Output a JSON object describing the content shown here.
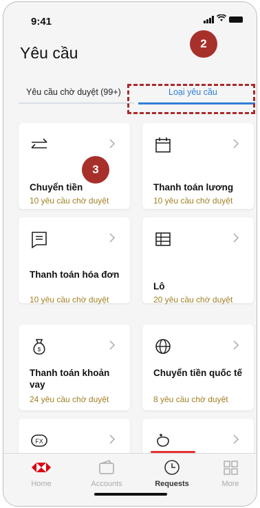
{
  "status_bar": {
    "time": "9:41"
  },
  "header": {
    "title": "Yêu cầu"
  },
  "tabs": [
    {
      "label": "Yêu cầu chờ duyệt (99+)"
    },
    {
      "label": "Loại yêu cầu"
    }
  ],
  "annotations": {
    "badge_2": "2",
    "badge_3": "3"
  },
  "cards": [
    {
      "name": "Chuyển tiền",
      "count": "10 yêu cầu chờ duyệt",
      "icon": "transfer-arrows-icon"
    },
    {
      "name": "Thanh toán lương",
      "count": "10 yêu cầu chờ duyệt",
      "icon": "calendar-icon"
    },
    {
      "name": "Thanh toán hóa đơn",
      "count": "10 yêu cầu chờ duyệt",
      "icon": "bill-icon"
    },
    {
      "name": "Lô",
      "count": "20 yêu cầu chờ duyệt",
      "icon": "table-icon"
    },
    {
      "name": "Thanh toán khoản vay",
      "count": "24 yêu cầu chờ duyệt",
      "icon": "money-bag-icon"
    },
    {
      "name": "Chuyển tiền quốc tế",
      "count": "8 yêu cầu chờ duyệt",
      "icon": "globe-icon"
    },
    {
      "name": "",
      "count": "",
      "icon": "fx-icon"
    },
    {
      "name": "",
      "count": "",
      "icon": "piggy-bank-icon"
    }
  ],
  "bottom_nav": [
    {
      "label": "Home",
      "icon": "hsbc-logo-icon"
    },
    {
      "label": "Accounts",
      "icon": "wallet-icon"
    },
    {
      "label": "Requests",
      "icon": "clock-icon",
      "active": true
    },
    {
      "label": "More",
      "icon": "grid-icon"
    }
  ],
  "colors": {
    "accent": "#2f7fd6",
    "annotation": "#a8302a",
    "count_text": "#a07e22",
    "brand_red": "#db0011"
  }
}
